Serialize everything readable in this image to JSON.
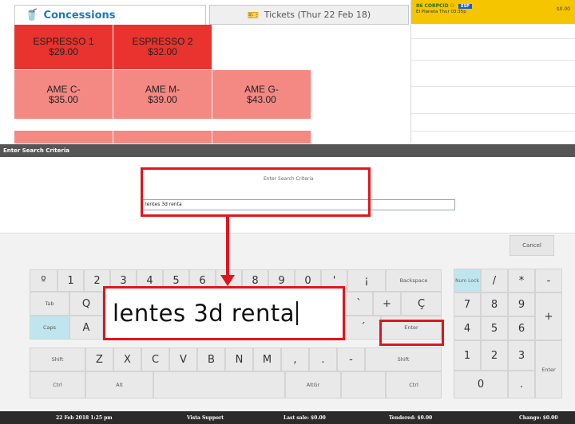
{
  "tabs": {
    "concessions": "Concessions",
    "tickets": "Tickets (Thur 22 Feb 18)"
  },
  "order": {
    "code": "86 CORPCID",
    "badge": "ESP",
    "subtitle": "El Planeta Thur 03:35p",
    "amount": "$0.00"
  },
  "products": [
    {
      "name": "ESPRESSO 1",
      "price": "$29.00"
    },
    {
      "name": "ESPRESSO 2",
      "price": "$32.00"
    },
    {
      "name": "AME C-",
      "price": "$35.00"
    },
    {
      "name": "AME M-",
      "price": "$39.00"
    },
    {
      "name": "AME G-",
      "price": "$43.00"
    }
  ],
  "dialog": {
    "title": "Enter Search Criteria",
    "label": "Enter Search Criteria",
    "value": "lentes 3d renta",
    "zoom_value": "lentes 3d renta",
    "cancel": "Cancel"
  },
  "keyboard": {
    "row1": [
      "º",
      "1",
      "2",
      "3",
      "4",
      "5",
      "6",
      "7",
      "8",
      "9",
      "0",
      "'",
      "¡",
      "Backspace"
    ],
    "row2": [
      "Tab",
      "Q",
      "`",
      "+",
      "Ç"
    ],
    "row3": [
      "Caps",
      "A",
      "´",
      "Enter"
    ],
    "row4": [
      "Shift",
      "Z",
      "X",
      "C",
      "V",
      "B",
      "N",
      "M",
      ",",
      ".",
      "-",
      "Shift"
    ],
    "row5": [
      "Ctrl",
      "Alt",
      "AltGr",
      "Ctrl"
    ]
  },
  "numpad": {
    "row1": [
      "Num Lock",
      "/",
      "*",
      "-"
    ],
    "row2": [
      "7",
      "8",
      "9",
      "+"
    ],
    "row3": [
      "4",
      "5",
      "6"
    ],
    "row4": [
      "1",
      "2",
      "3",
      "Enter"
    ],
    "row5": [
      "0",
      "."
    ]
  },
  "status": {
    "datetime": "22 Feb 2018 1:25 pm",
    "user": "Vista Support",
    "last_sale": "Last sale: $0.00",
    "tendered": "Tendered: $0.00",
    "change": "Change: $0.00"
  },
  "colors": {
    "tile_dark": "#e8332e",
    "tile_light": "#f48882",
    "highlight": "#e1151b",
    "accent": "#1a7abf",
    "order_header": "#f5c500"
  }
}
